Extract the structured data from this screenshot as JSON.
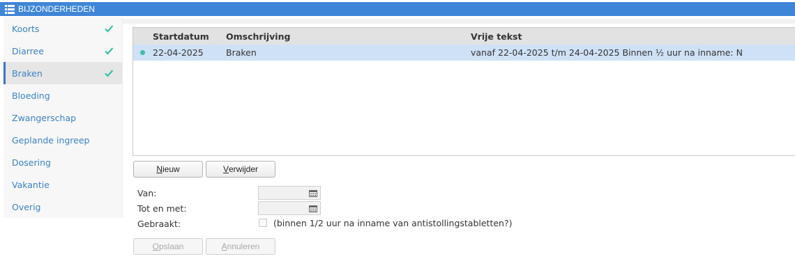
{
  "window": {
    "title": "BIJZONDERHEDEN",
    "title_icon": "list-icon",
    "accent": "#3f86d8"
  },
  "sidebar": {
    "items": [
      {
        "label": "Koorts",
        "checked": true
      },
      {
        "label": "Diarree",
        "checked": true
      },
      {
        "label": "Braken",
        "checked": true,
        "active": true
      },
      {
        "label": "Bloeding",
        "checked": false
      },
      {
        "label": "Zwangerschap",
        "checked": false
      },
      {
        "label": "Geplande ingreep",
        "checked": false
      },
      {
        "label": "Dosering",
        "checked": false
      },
      {
        "label": "Vakantie",
        "checked": false
      },
      {
        "label": "Overig",
        "checked": false
      }
    ],
    "check_color": "#3dbfa8"
  },
  "grid": {
    "headers": [
      "Startdatum",
      "Omschrijving",
      "Vrije tekst"
    ],
    "rows": [
      {
        "status": "green-dot",
        "start": "22-04-2025",
        "desc": "Braken",
        "text": "vanaf 22-04-2025 t/m 24-04-2025 Binnen ½ uur na inname: N"
      }
    ]
  },
  "actions": {
    "new_label": "Nieuw",
    "new_mnemonic": "N",
    "new_rest": "ieuw",
    "delete_label": "Verwijder",
    "delete_mnemonic": "V",
    "delete_rest": "erwijder"
  },
  "form": {
    "from_label": "Van:",
    "from_value": "",
    "until_label": "Tot en met:",
    "until_value": "",
    "vomited_label": "Gebraakt:",
    "vomited_checked": false,
    "vomited_text": "(binnen 1/2 uur na inname van antistollingstabletten?)",
    "date_icon": "calendar-icon"
  },
  "footer": {
    "save_label": "Opslaan",
    "save_mnemonic": "O",
    "save_rest": "pslaan",
    "cancel_label": "Annuleren",
    "cancel_mnemonic": "A",
    "cancel_rest": "nnuleren"
  }
}
